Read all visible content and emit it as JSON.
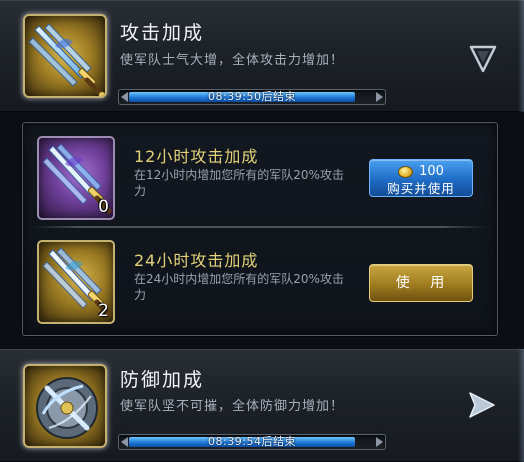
{
  "attack_section": {
    "title": "攻击加成",
    "description": "使军队士气大增，全体攻击力增加！",
    "timer_text": "08:39:50后结束",
    "timer_progress": 0.92,
    "icon": "sword-item-icon",
    "toggle_icon": "chevron-down-icon"
  },
  "items": [
    {
      "id": "12h",
      "title": "12小时攻击加成",
      "description": "在12小时内增加您所有的军队20%攻击力",
      "quantity": "0",
      "icon": "purple-sword-icon",
      "button": {
        "type": "buy",
        "price": "100",
        "label": "购买并使用",
        "currency_icon": "gold-coin-icon"
      }
    },
    {
      "id": "24h",
      "title": "24小时攻击加成",
      "description": "在24小时内增加您所有的军队20%攻击力",
      "quantity": "2",
      "icon": "gold-sword-icon",
      "button": {
        "type": "use",
        "label": "使 用"
      }
    }
  ],
  "defense_section": {
    "title": "防御加成",
    "description": "使军队坚不可摧，全体防御力增加！",
    "timer_text": "08:39:54后结束",
    "timer_progress": 0.92,
    "icon": "shield-item-icon",
    "toggle_icon": "chevron-right-icon"
  },
  "colors": {
    "timer_fill": "#1f78d6",
    "item_title": "#e3d27a",
    "buy_button": "#1f6cc6",
    "use_button": "#9f7c1f"
  }
}
